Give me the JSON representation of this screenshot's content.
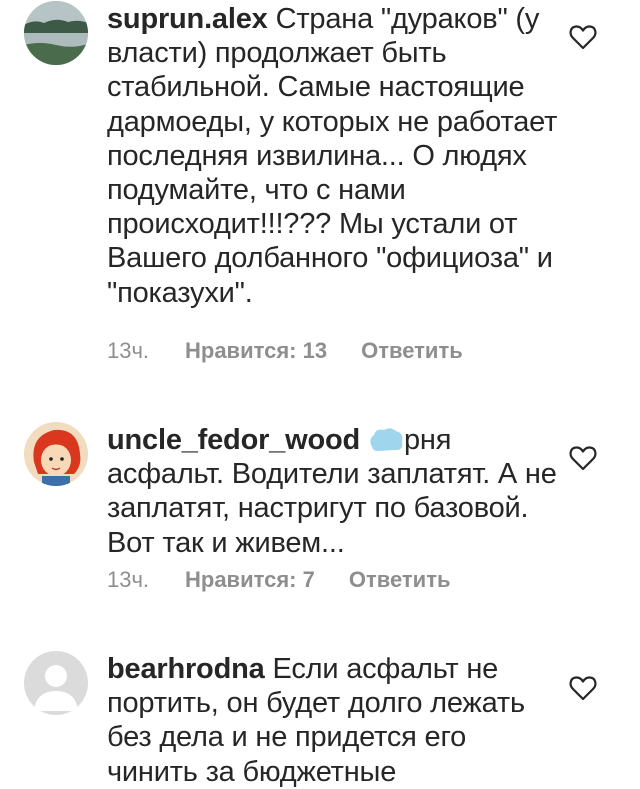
{
  "comments": [
    {
      "username": "suprun.alex",
      "text": "Страна \"дураков\" (у власти) продолжает быть стабильной. Самые настоящие дармоеды, у которых не работает последняя извилина... О людях подумайте, что с нами происходит!!!??? Мы устали от Вашего долбанного \"официоза\" и \"показухи\".",
      "time": "13ч.",
      "likes": "Нравится: 13",
      "reply": "Ответить"
    },
    {
      "username": "uncle_fedor_wood",
      "text_after_emoji": "рня асфальт. Водители заплатят. А не заплатят, настригут по базовой. Вот так и живем...",
      "time": "13ч.",
      "likes": "Нравится: 7",
      "reply": "Ответить"
    },
    {
      "username": "bearhrodna",
      "text": "Если асфальт не портить, он будет долго лежать без дела и не придется его чинить за бюджетные"
    }
  ],
  "colors": {
    "text": "#262626",
    "secondary": "#8e8e8e",
    "emoji_blob": "#9fd6ee"
  },
  "icons": {
    "like": "heart-outline-icon",
    "emoji": "cloud-emoji-icon"
  }
}
